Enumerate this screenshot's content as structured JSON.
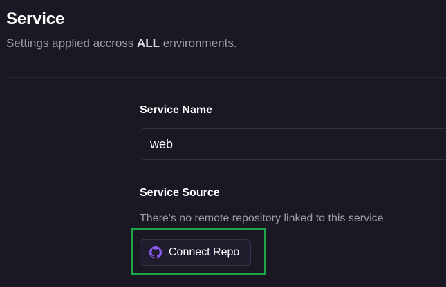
{
  "header": {
    "title": "Service",
    "subtitle_before": "Settings applied accross",
    "subtitle_strong": "ALL",
    "subtitle_after": "environments."
  },
  "service_name": {
    "label": "Service Name",
    "value": "web"
  },
  "service_source": {
    "label": "Service Source",
    "helper": "There's no remote repository linked to this service",
    "connect_button_label": "Connect Repo",
    "connect_button_icon": "github-icon"
  },
  "colors": {
    "background": "#1a1823",
    "accent_purple": "#8b5cf6",
    "highlight_green": "#1fa64a"
  }
}
